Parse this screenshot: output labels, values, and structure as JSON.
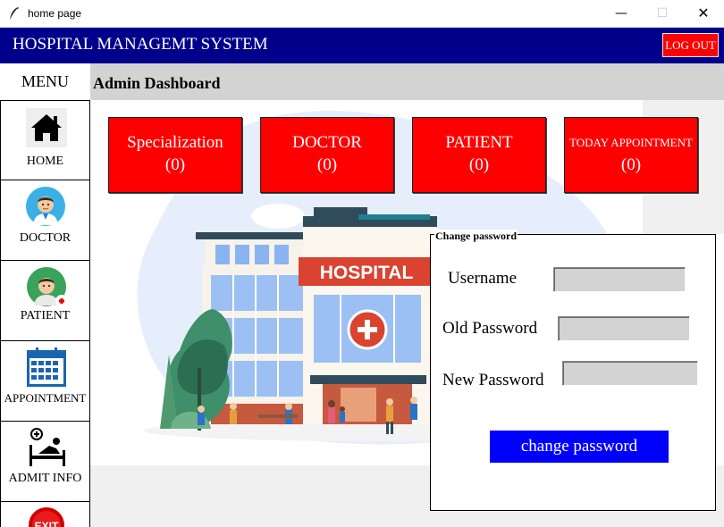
{
  "window": {
    "title": "home page",
    "minimize": "—",
    "maximize": "☐",
    "close": "✕"
  },
  "header": {
    "title": "HOSPITAL MANAGEMT SYSTEM",
    "logout_label": "LOG OUT"
  },
  "sidebar": {
    "menu_label": "MENU",
    "items": [
      {
        "label": "HOME",
        "icon": "home-icon"
      },
      {
        "label": "DOCTOR",
        "icon": "doctor-icon"
      },
      {
        "label": "PATIENT",
        "icon": "patient-icon"
      },
      {
        "label": "APPOINTMENT",
        "icon": "calendar-icon"
      },
      {
        "label": "ADMIT INFO",
        "icon": "hospital-bed-icon"
      },
      {
        "label": "EXIT",
        "icon": "exit-icon"
      }
    ]
  },
  "main": {
    "title": "Admin Dashboard",
    "illustration_sign": "HOSPITAL",
    "cards": [
      {
        "label": "Specialization",
        "count": "(0)"
      },
      {
        "label": "DOCTOR",
        "count": "(0)"
      },
      {
        "label": "PATIENT",
        "count": "(0)"
      },
      {
        "label": "TODAY APPOINTMENT",
        "count": "(0)"
      }
    ]
  },
  "change_password": {
    "legend": "Change password",
    "username_label": "Username",
    "username_value": "",
    "old_password_label": "Old Password",
    "old_password_value": "",
    "new_password_label": "New Password",
    "new_password_value": "",
    "submit_label": "change password"
  },
  "colors": {
    "header_bg": "#00008b",
    "card_bg": "#ff0000",
    "button_bg": "#0000ff",
    "logout_bg": "#ff0000"
  }
}
